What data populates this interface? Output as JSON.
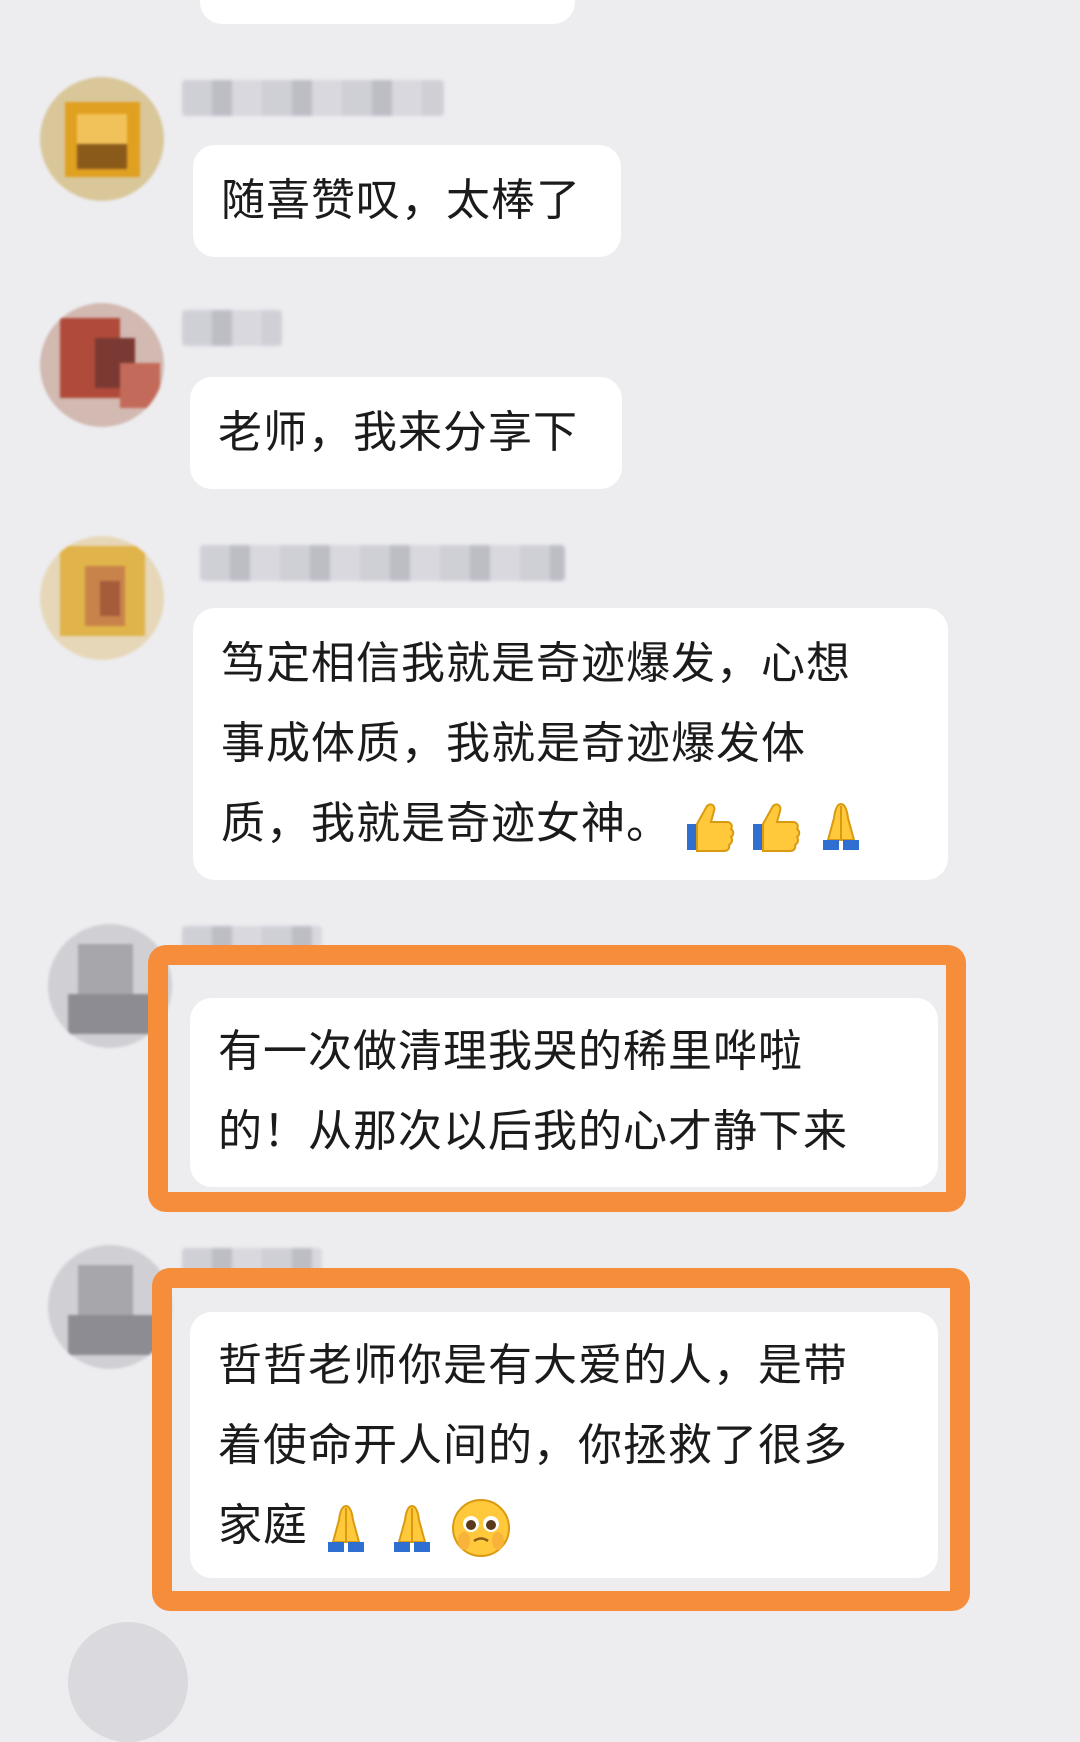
{
  "messages": [
    {
      "id": "m1",
      "lines": [
        "随喜赞叹，太棒了"
      ],
      "emojis": []
    },
    {
      "id": "m2",
      "lines": [
        "老师，我来分享下"
      ],
      "emojis": []
    },
    {
      "id": "m3",
      "lines": [
        "笃定相信我就是奇迹爆发，心想",
        "事成体质，我就是奇迹爆发体",
        "质，我就是奇迹女神。"
      ],
      "emojis": [
        "thumbs-up",
        "thumbs-up",
        "folded-hands"
      ]
    },
    {
      "id": "m4",
      "lines": [
        "有一次做清理我哭的稀里哗啦",
        "的！从那次以后我的心才静下来"
      ],
      "emojis": [],
      "highlighted": true
    },
    {
      "id": "m5",
      "lines": [
        "哲哲老师你是有大爱的人，是带",
        "着使命开人间的，你拯救了很多",
        "家庭"
      ],
      "emojis": [
        "folded-hands",
        "folded-hands",
        "pleading-face"
      ],
      "highlighted": true
    }
  ],
  "colors": {
    "background": "#ededf0",
    "bubble": "#ffffff",
    "highlight_border": "#f58d3a",
    "text": "#1b1b1b"
  }
}
